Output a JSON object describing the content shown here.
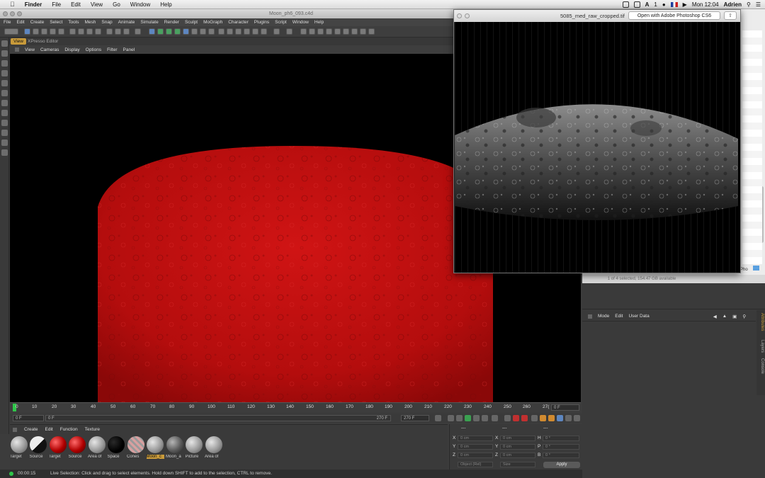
{
  "menubar": {
    "app": "Finder",
    "items": [
      "File",
      "Edit",
      "View",
      "Go",
      "Window",
      "Help"
    ],
    "status_a": "A",
    "status_1": "1",
    "clock": "Mon 12:04",
    "user": "Adrien"
  },
  "c4d": {
    "title": "Moon_ph6_093.c4d",
    "menu": [
      "File",
      "Edit",
      "Create",
      "Select",
      "Tools",
      "Mesh",
      "Snap",
      "Animate",
      "Simulate",
      "Render",
      "Sculpt",
      "MoGraph",
      "Character",
      "Plugins",
      "Script",
      "Window",
      "Help"
    ],
    "viewport_tabs": {
      "active": "View",
      "other": "XPresso Editor"
    },
    "viewport_menu": [
      "View",
      "Cameras",
      "Display",
      "Options",
      "Filter",
      "Panel"
    ],
    "timeline_ticks": [
      "0",
      "10",
      "20",
      "30",
      "40",
      "50",
      "60",
      "70",
      "80",
      "90",
      "100",
      "110",
      "120",
      "130",
      "140",
      "150",
      "160",
      "170",
      "180",
      "190",
      "200",
      "210",
      "220",
      "230",
      "240",
      "250",
      "260",
      "27("
    ],
    "current_frame": "0 F",
    "transport": {
      "start_field": "0 F",
      "slider_start": "0 F",
      "slider_end": "270 F",
      "end_field": "270 F"
    },
    "material_menu": [
      "Create",
      "Edit",
      "Function",
      "Texture"
    ],
    "materials": [
      {
        "label": "Target",
        "kind": "grey"
      },
      {
        "label": "Source",
        "kind": "half"
      },
      {
        "label": "Target",
        "kind": "red"
      },
      {
        "label": "Source",
        "kind": "red"
      },
      {
        "label": "Area of",
        "kind": "grey"
      },
      {
        "label": "Space",
        "kind": "black"
      },
      {
        "label": "Cones",
        "kind": "striped"
      },
      {
        "label": "Moon_c",
        "kind": "grey",
        "selected": true
      },
      {
        "label": "Moon_a",
        "kind": "dark"
      },
      {
        "label": "Picture",
        "kind": "grey"
      },
      {
        "label": "Area of",
        "kind": "grey"
      }
    ],
    "coordinates": {
      "header": [
        "---",
        "---",
        "---"
      ],
      "rows": [
        {
          "a": "X",
          "av": "0 cm",
          "b": "X",
          "bv": "0 cm",
          "c": "H",
          "cv": "0 °"
        },
        {
          "a": "Y",
          "av": "0 cm",
          "b": "Y",
          "bv": "0 cm",
          "c": "P",
          "cv": "0 °"
        },
        {
          "a": "Z",
          "av": "0 cm",
          "b": "Z",
          "bv": "0 cm",
          "c": "B",
          "cv": "0 °"
        }
      ],
      "mode_select": "Object (Rel)",
      "size_select": "Size",
      "apply_label": "Apply"
    },
    "status_time": "00:00:15",
    "status_message": "Live Selection: Click and drag to select elements. Hold down SHIFT to add to the selection, CTRL to remove."
  },
  "attributes": {
    "menu": [
      "Mode",
      "Edit",
      "User Data"
    ],
    "vertical_tabs": [
      "Attributes",
      "Layers",
      "Console"
    ]
  },
  "finder": {
    "status": "1 of 4 selected, 154.47 GB available",
    "row_label": "Pho"
  },
  "quicklook": {
    "filename": "5085_med_raw_cropped.tif",
    "open_button": "Open with Adobe Photoshop CS6"
  },
  "colors": {
    "accent": "#c89a3a",
    "moon_red": "#c01010",
    "playhead": "#2fc64a"
  }
}
